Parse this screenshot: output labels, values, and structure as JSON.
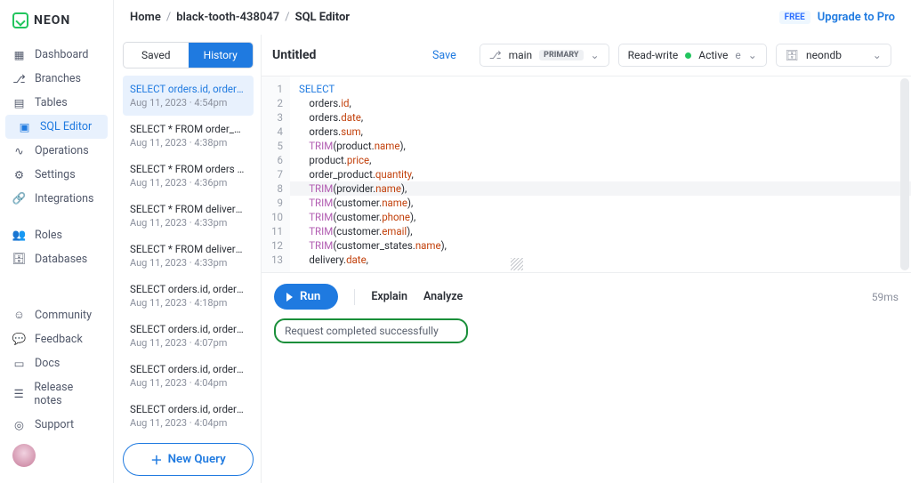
{
  "brand": "NEON",
  "breadcrumb": {
    "home": "Home",
    "project": "black-tooth-438047",
    "current": "SQL Editor"
  },
  "upgrade": {
    "badge": "FREE",
    "link": "Upgrade to Pro"
  },
  "sidebar": {
    "items": [
      {
        "label": "Dashboard",
        "icon": "grid"
      },
      {
        "label": "Branches",
        "icon": "branch"
      },
      {
        "label": "Tables",
        "icon": "table"
      },
      {
        "label": "SQL Editor",
        "icon": "sql",
        "active": true
      },
      {
        "label": "Operations",
        "icon": "activity"
      },
      {
        "label": "Settings",
        "icon": "gear"
      },
      {
        "label": "Integrations",
        "icon": "link"
      }
    ],
    "secondary": [
      {
        "label": "Roles",
        "icon": "users"
      },
      {
        "label": "Databases",
        "icon": "database"
      }
    ],
    "footer": [
      {
        "label": "Community",
        "icon": "people"
      },
      {
        "label": "Feedback",
        "icon": "chat"
      },
      {
        "label": "Docs",
        "icon": "book"
      },
      {
        "label": "Release notes",
        "icon": "note"
      },
      {
        "label": "Support",
        "icon": "life"
      }
    ]
  },
  "history": {
    "tabs": {
      "saved": "Saved",
      "history": "History"
    },
    "items": [
      {
        "query": "SELECT orders.id, orders.date...",
        "date": "Aug 11, 2023 · 4:54pm",
        "active": true
      },
      {
        "query": "SELECT * FROM order_produ...",
        "date": "Aug 11, 2023 · 4:38pm"
      },
      {
        "query": "SELECT * FROM orders WHER...",
        "date": "Aug 11, 2023 · 4:36pm"
      },
      {
        "query": "SELECT * FROM delivery WHE...",
        "date": "Aug 11, 2023 · 4:33pm"
      },
      {
        "query": "SELECT * FROM delivery WHE...",
        "date": "Aug 11, 2023 · 4:33pm"
      },
      {
        "query": "SELECT orders.id, orders.date...",
        "date": "Aug 11, 2023 · 4:18pm"
      },
      {
        "query": "SELECT orders.id, orders.date...",
        "date": "Aug 11, 2023 · 4:07pm"
      },
      {
        "query": "SELECT orders.id, orders.date...",
        "date": "Aug 11, 2023 · 4:04pm"
      },
      {
        "query": "SELECT orders.id, orders.date...",
        "date": "Aug 11, 2023 · 4:04pm"
      }
    ],
    "new_query": "New Query"
  },
  "editor": {
    "title": "Untitled",
    "save": "Save",
    "branch": {
      "name": "main",
      "badge": "PRIMARY"
    },
    "mode": {
      "label": "Read-write",
      "status": "Active",
      "suffix": "e"
    },
    "database": "neondb",
    "code": {
      "lines": [
        "1",
        "2",
        "3",
        "4",
        "5",
        "6",
        "7",
        "8",
        "9",
        "10",
        "11",
        "12",
        "13"
      ],
      "l1": "SELECT",
      "l2": "orders.id,",
      "l3": "orders.date,",
      "l4": "orders.sum,",
      "l5a": "TRIM",
      "l5b": "(product.name),",
      "l6": "product.price,",
      "l7": "order_product.quantity,",
      "l8a": "TRIM",
      "l8b": "(provider.name),",
      "l9a": "TRIM",
      "l9b": "(customer.name),",
      "l10a": "TRIM",
      "l10b": "(customer.phone),",
      "l11a": "TRIM",
      "l11b": "(customer.email),",
      "l12a": "TRIM",
      "l12b": "(customer_states.name),",
      "l13": "delivery.date,"
    }
  },
  "results": {
    "run": "Run",
    "explain": "Explain",
    "analyze": "Analyze",
    "timing": "59ms",
    "status": "Request completed successfully"
  }
}
